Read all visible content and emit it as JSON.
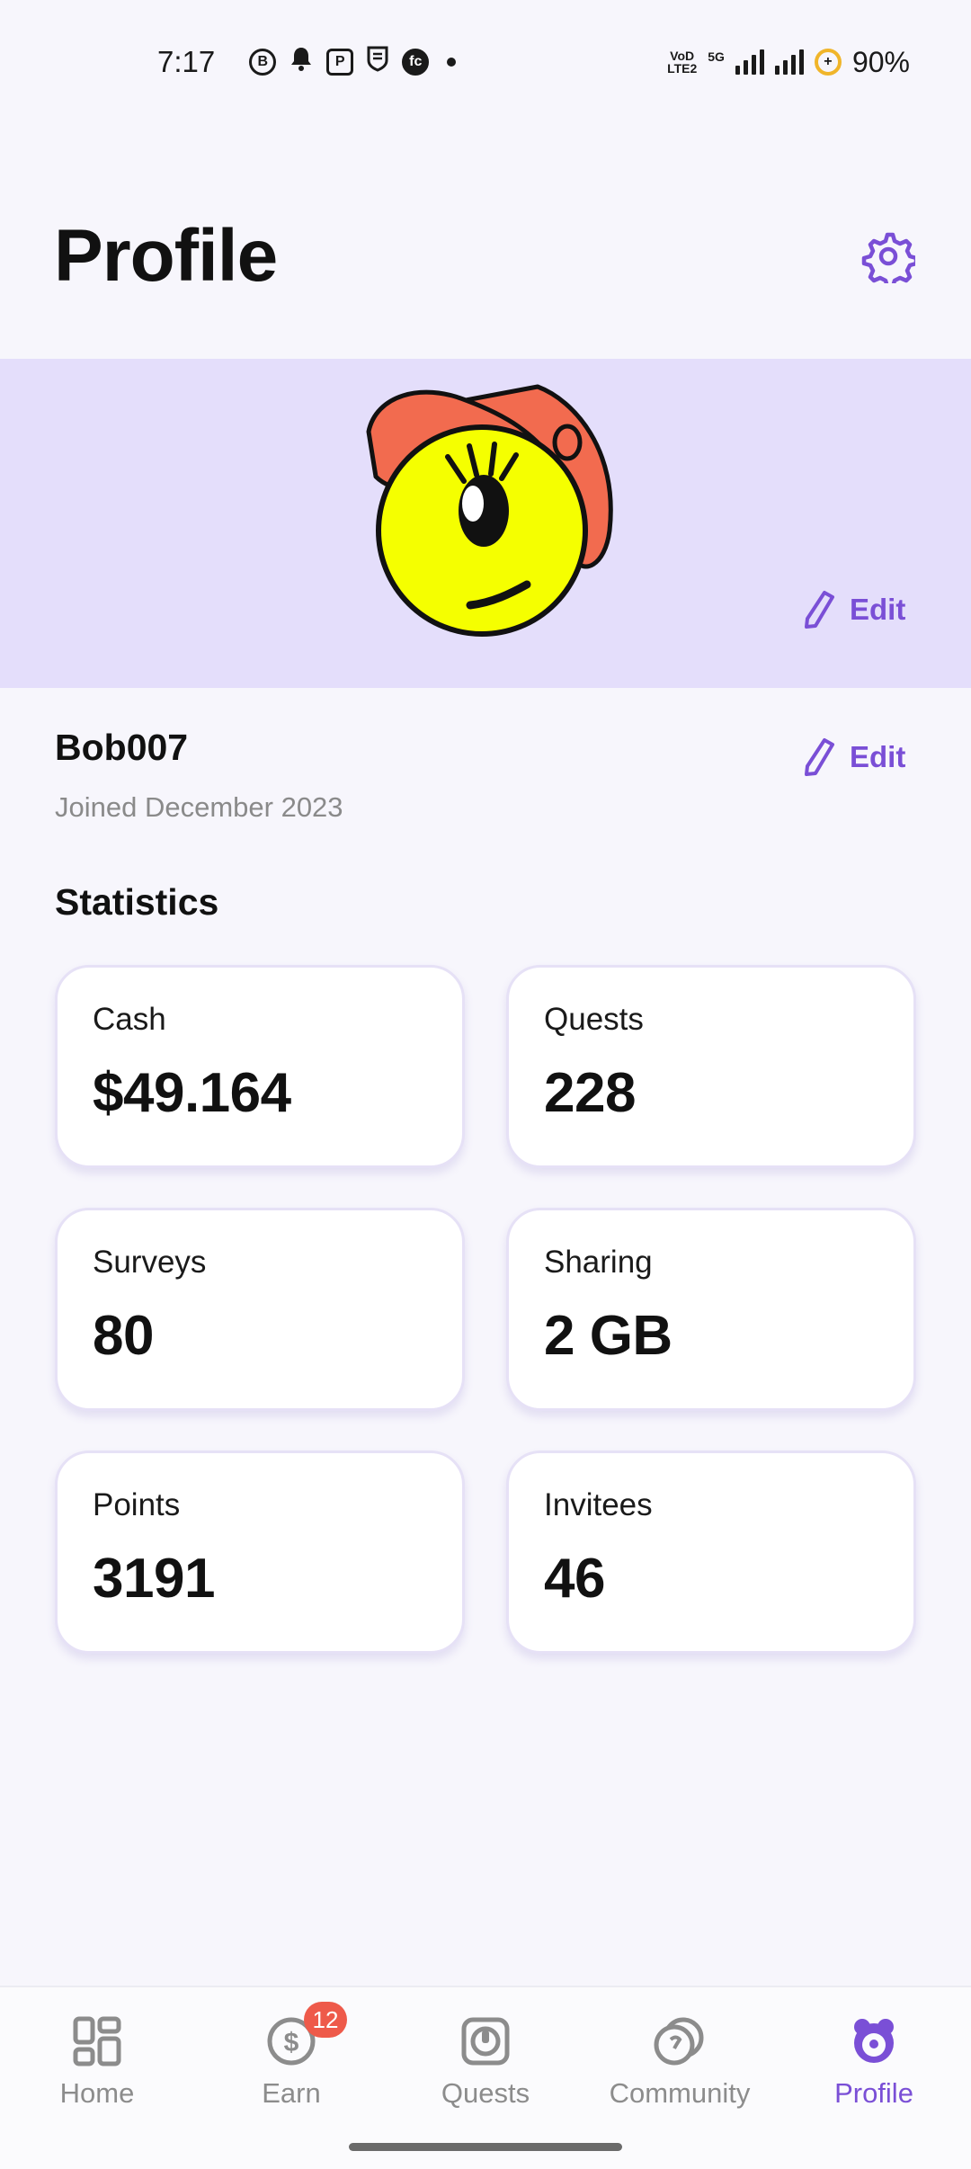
{
  "status_bar": {
    "time": "7:17",
    "notification_icons": [
      "B",
      "bell",
      "P",
      "shield",
      "fc"
    ],
    "network_label_top": "VoD",
    "network_label_bottom": "LTE2",
    "network_type": "5G",
    "battery": "90%"
  },
  "header": {
    "title": "Profile",
    "settings_icon": "gear-icon"
  },
  "banner": {
    "edit_label": "Edit",
    "background": "#e4defb"
  },
  "user": {
    "name": "Bob007",
    "joined": "Joined December 2023",
    "edit_label": "Edit"
  },
  "statistics": {
    "title": "Statistics",
    "cards": [
      {
        "label": "Cash",
        "value": "$49.164"
      },
      {
        "label": "Quests",
        "value": "228"
      },
      {
        "label": "Surveys",
        "value": "80"
      },
      {
        "label": "Sharing",
        "value": "2 GB"
      },
      {
        "label": "Points",
        "value": "3191"
      },
      {
        "label": "Invitees",
        "value": "46"
      }
    ]
  },
  "bottom_nav": {
    "items": [
      {
        "label": "Home",
        "icon": "home-grid-icon",
        "active": false
      },
      {
        "label": "Earn",
        "icon": "dollar-coin-icon",
        "active": false,
        "badge": "12"
      },
      {
        "label": "Quests",
        "icon": "quests-icon",
        "active": false
      },
      {
        "label": "Community",
        "icon": "community-coins-icon",
        "active": false
      },
      {
        "label": "Profile",
        "icon": "profile-icon",
        "active": true
      }
    ]
  },
  "colors": {
    "accent": "#7a4fd6",
    "badge": "#ee5a4a",
    "background": "#f7f6fc"
  }
}
